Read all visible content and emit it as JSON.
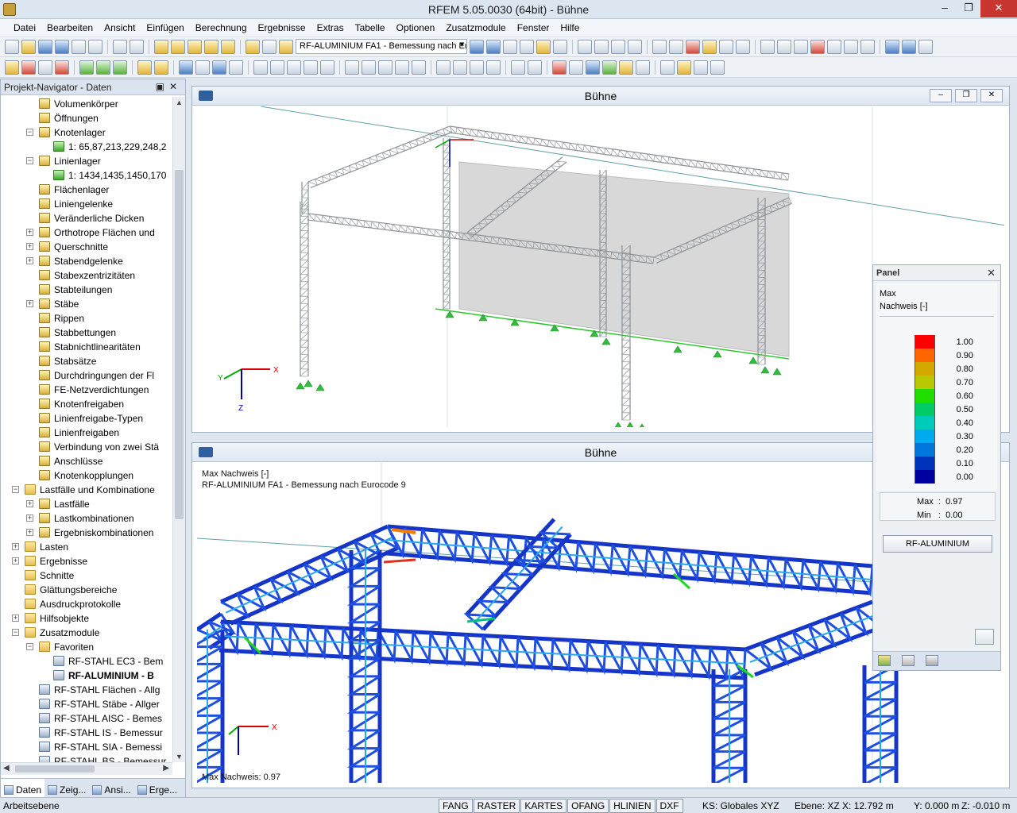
{
  "window": {
    "title": "RFEM 5.05.0030 (64bit) - Bühne"
  },
  "menu": [
    "Datei",
    "Bearbeiten",
    "Ansicht",
    "Einfügen",
    "Berechnung",
    "Ergebnisse",
    "Extras",
    "Tabelle",
    "Optionen",
    "Zusatzmodule",
    "Fenster",
    "Hilfe"
  ],
  "toolbar": {
    "case_combo": "RF-ALUMINIUM FA1 - Bemessung nach Eurocode 9"
  },
  "navigator": {
    "title": "Projekt-Navigator - Daten",
    "items": [
      {
        "label": "Volumenkörper",
        "level": 3,
        "exp": ""
      },
      {
        "label": "Öffnungen",
        "level": 3,
        "exp": ""
      },
      {
        "label": "Knotenlager",
        "level": 3,
        "exp": "-"
      },
      {
        "label": "1: 65,87,213,229,248,2",
        "level": 4,
        "exp": "",
        "icon": "green"
      },
      {
        "label": "Linienlager",
        "level": 3,
        "exp": "-"
      },
      {
        "label": "1: 1434,1435,1450,170",
        "level": 4,
        "exp": "",
        "icon": "green"
      },
      {
        "label": "Flächenlager",
        "level": 3,
        "exp": ""
      },
      {
        "label": "Liniengelenke",
        "level": 3,
        "exp": ""
      },
      {
        "label": "Veränderliche Dicken",
        "level": 3,
        "exp": ""
      },
      {
        "label": "Orthotrope Flächen und",
        "level": 3,
        "exp": "+"
      },
      {
        "label": "Querschnitte",
        "level": 3,
        "exp": "+"
      },
      {
        "label": "Stabendgelenke",
        "level": 3,
        "exp": "+"
      },
      {
        "label": "Stabexzentrizitäten",
        "level": 3,
        "exp": ""
      },
      {
        "label": "Stabteilungen",
        "level": 3,
        "exp": ""
      },
      {
        "label": "Stäbe",
        "level": 3,
        "exp": "+"
      },
      {
        "label": "Rippen",
        "level": 3,
        "exp": ""
      },
      {
        "label": "Stabbettungen",
        "level": 3,
        "exp": ""
      },
      {
        "label": "Stabnichtlinearitäten",
        "level": 3,
        "exp": ""
      },
      {
        "label": "Stabsätze",
        "level": 3,
        "exp": ""
      },
      {
        "label": "Durchdringungen der Fl",
        "level": 3,
        "exp": ""
      },
      {
        "label": "FE-Netzverdichtungen",
        "level": 3,
        "exp": ""
      },
      {
        "label": "Knotenfreigaben",
        "level": 3,
        "exp": ""
      },
      {
        "label": "Linienfreigabe-Typen",
        "level": 3,
        "exp": ""
      },
      {
        "label": "Linienfreigaben",
        "level": 3,
        "exp": ""
      },
      {
        "label": "Verbindung von zwei Stä",
        "level": 3,
        "exp": ""
      },
      {
        "label": "Anschlüsse",
        "level": 3,
        "exp": ""
      },
      {
        "label": "Knotenkopplungen",
        "level": 3,
        "exp": ""
      },
      {
        "label": "Lastfälle und Kombinatione",
        "level": 2,
        "exp": "-",
        "icon": "folder"
      },
      {
        "label": "Lastfälle",
        "level": 3,
        "exp": "+"
      },
      {
        "label": "Lastkombinationen",
        "level": 3,
        "exp": "+"
      },
      {
        "label": "Ergebniskombinationen",
        "level": 3,
        "exp": "+"
      },
      {
        "label": "Lasten",
        "level": 2,
        "exp": "+",
        "icon": "folder"
      },
      {
        "label": "Ergebnisse",
        "level": 2,
        "exp": "+",
        "icon": "folder"
      },
      {
        "label": "Schnitte",
        "level": 2,
        "exp": "",
        "icon": "folder"
      },
      {
        "label": "Glättungsbereiche",
        "level": 2,
        "exp": "",
        "icon": "folder"
      },
      {
        "label": "Ausdruckprotokolle",
        "level": 2,
        "exp": "",
        "icon": "folder"
      },
      {
        "label": "Hilfsobjekte",
        "level": 2,
        "exp": "+",
        "icon": "folder"
      },
      {
        "label": "Zusatzmodule",
        "level": 2,
        "exp": "-",
        "icon": "folder"
      },
      {
        "label": "Favoriten",
        "level": 3,
        "exp": "-",
        "icon": "folder"
      },
      {
        "label": "RF-STAHL EC3 - Bem",
        "level": 4,
        "exp": "",
        "icon": "mod"
      },
      {
        "label": "RF-ALUMINIUM - B",
        "level": 4,
        "exp": "",
        "icon": "mod",
        "bold": true
      },
      {
        "label": "RF-STAHL Flächen - Allg",
        "level": 3,
        "exp": "",
        "icon": "mod"
      },
      {
        "label": "RF-STAHL Stäbe - Allger",
        "level": 3,
        "exp": "",
        "icon": "mod"
      },
      {
        "label": "RF-STAHL AISC - Bemes",
        "level": 3,
        "exp": "",
        "icon": "mod"
      },
      {
        "label": "RF-STAHL IS - Bemessur",
        "level": 3,
        "exp": "",
        "icon": "mod"
      },
      {
        "label": "RF-STAHL SIA - Bemessi",
        "level": 3,
        "exp": "",
        "icon": "mod"
      },
      {
        "label": "RF-STAHL BS - Bemessur",
        "level": 3,
        "exp": "",
        "icon": "mod"
      }
    ],
    "tabs": [
      "Daten",
      "Zeig...",
      "Ansi...",
      "Erge..."
    ]
  },
  "view_top": {
    "title": "Bühne"
  },
  "view_bottom": {
    "title": "Bühne",
    "label1": "Max Nachweis [-]",
    "label2": "RF-ALUMINIUM FA1 - Bemessung nach Eurocode 9",
    "footer": "Max Nachweis: 0.97"
  },
  "axes": {
    "x": "X",
    "y": "Y",
    "z": "Z"
  },
  "panel": {
    "title": "Panel",
    "line1": "Max",
    "line2": "Nachweis [-]",
    "legend": [
      {
        "value": "1.00",
        "color": "#ff0000"
      },
      {
        "value": "0.90",
        "color": "#ff6600"
      },
      {
        "value": "0.80",
        "color": "#d4aa00"
      },
      {
        "value": "0.70",
        "color": "#b9c800"
      },
      {
        "value": "0.60",
        "color": "#22dd00"
      },
      {
        "value": "0.50",
        "color": "#00cc66"
      },
      {
        "value": "0.40",
        "color": "#00ccbb"
      },
      {
        "value": "0.30",
        "color": "#00aaee"
      },
      {
        "value": "0.20",
        "color": "#0077dd"
      },
      {
        "value": "0.10",
        "color": "#0033bb"
      },
      {
        "value": "0.00",
        "color": "#0000a0"
      }
    ],
    "max_label": "Max",
    "max_value": "0.97",
    "min_label": "Min",
    "min_value": "0.00",
    "button": "RF-ALUMINIUM"
  },
  "status": {
    "left": "Arbeitsebene",
    "toggles": [
      "FANG",
      "RASTER",
      "KARTES",
      "OFANG",
      "HLINIEN",
      "DXF"
    ],
    "ks": "KS: Globales XYZ",
    "ebene": "Ebene: XZ",
    "x": "X:  12.792 m",
    "y": "Y:  0.000 m",
    "z": "Z:  -0.010 m"
  }
}
